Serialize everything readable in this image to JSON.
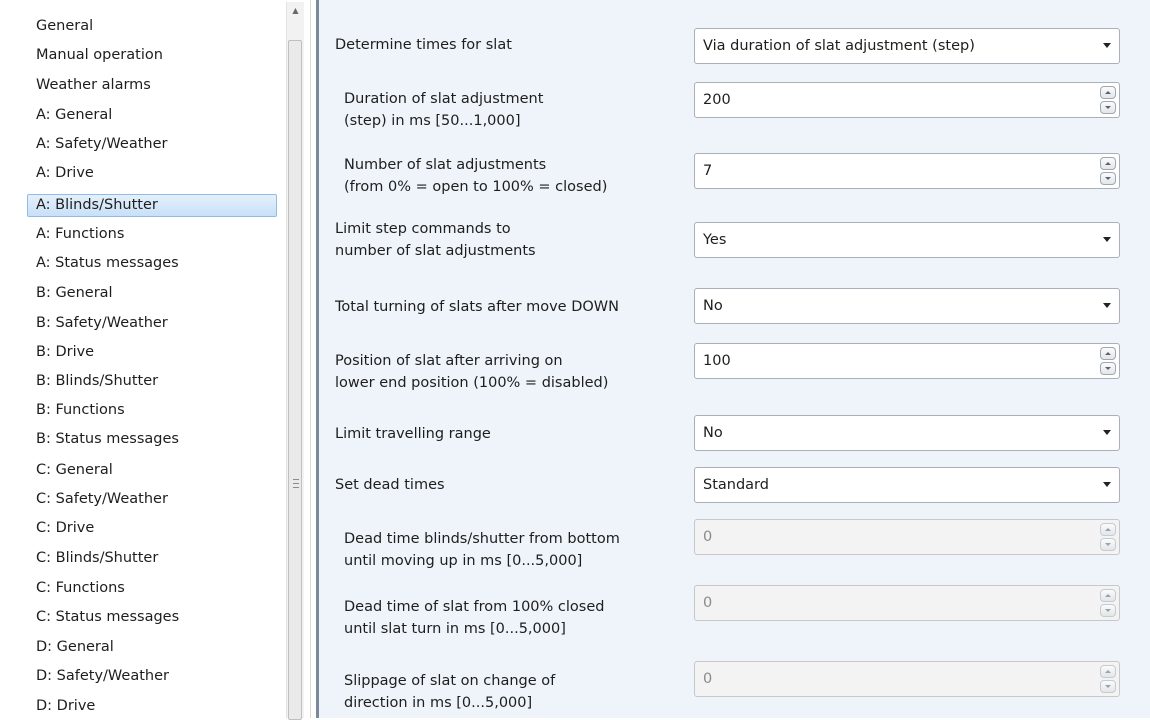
{
  "nav": {
    "items": [
      {
        "label": "General"
      },
      {
        "label": "Manual operation"
      },
      {
        "label": "Weather alarms"
      },
      {
        "label": "A: General"
      },
      {
        "label": "A: Safety/Weather"
      },
      {
        "label": "A: Drive"
      },
      {
        "label": "A: Blinds/Shutter",
        "selected": true
      },
      {
        "label": "A: Functions"
      },
      {
        "label": "A: Status messages"
      },
      {
        "label": "B: General"
      },
      {
        "label": "B: Safety/Weather"
      },
      {
        "label": "B: Drive"
      },
      {
        "label": "B: Blinds/Shutter"
      },
      {
        "label": "B: Functions"
      },
      {
        "label": "B: Status messages"
      },
      {
        "label": "C: General"
      },
      {
        "label": "C: Safety/Weather"
      },
      {
        "label": "C: Drive"
      },
      {
        "label": "C: Blinds/Shutter"
      },
      {
        "label": "C: Functions"
      },
      {
        "label": "C: Status messages"
      },
      {
        "label": "D: General"
      },
      {
        "label": "D: Safety/Weather"
      },
      {
        "label": "D: Drive"
      }
    ],
    "selected_color": "#c9e0f7"
  },
  "params": [
    {
      "label_lines": [
        "Determine times for slat"
      ],
      "control": "dropdown",
      "value": "Via duration of slat adjustment (step)"
    },
    {
      "label_lines": [
        "Duration of slat adjustment",
        "(step) in ms [50...1,000]"
      ],
      "control": "spinner",
      "value": "200",
      "indent": true
    },
    {
      "label_lines": [
        "Number of slat adjustments",
        "(from 0% = open to 100% = closed)"
      ],
      "control": "spinner",
      "value": "7",
      "indent": true
    },
    {
      "label_lines": [
        "Limit step commands to",
        "number of slat adjustments"
      ],
      "control": "dropdown",
      "value": "Yes"
    },
    {
      "label_lines": [
        "Total turning of slats after move DOWN"
      ],
      "control": "dropdown",
      "value": "No"
    },
    {
      "label_lines": [
        "Position of slat after arriving on",
        "lower end position (100% = disabled)"
      ],
      "control": "spinner",
      "value": "100"
    },
    {
      "label_lines": [
        "Limit travelling range"
      ],
      "control": "dropdown",
      "value": "No"
    },
    {
      "label_lines": [
        "Set dead times"
      ],
      "control": "dropdown",
      "value": "Standard"
    },
    {
      "label_lines": [
        "Dead time blinds/shutter from bottom",
        "until moving up in ms [0...5,000]"
      ],
      "control": "spinner",
      "value": "0",
      "indent": true,
      "disabled": true
    },
    {
      "label_lines": [
        "Dead time of slat from 100% closed",
        "until slat turn in ms [0...5,000]"
      ],
      "control": "spinner",
      "value": "0",
      "indent": true,
      "disabled": true
    },
    {
      "label_lines": [
        "Slippage of slat on change of",
        "direction in ms [0...5,000]"
      ],
      "control": "spinner",
      "value": "0",
      "indent": true,
      "disabled": true
    }
  ],
  "colors": {
    "panel_background": "#eef4fa",
    "disabled_field": "#f3f3f3"
  }
}
